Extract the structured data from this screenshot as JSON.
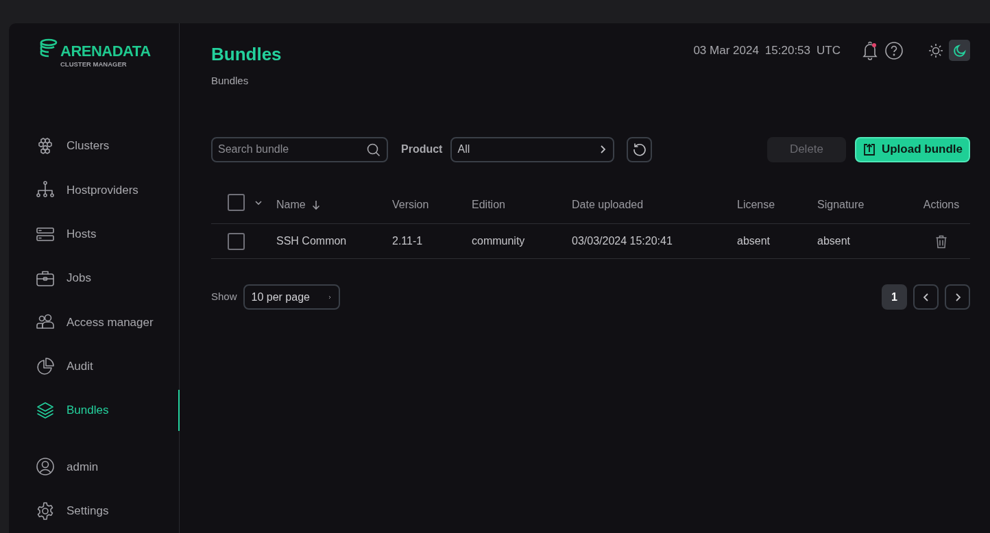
{
  "logo": {
    "title": "ARENADATA",
    "subtitle": "CLUSTER MANAGER"
  },
  "sidebar": {
    "items": [
      {
        "label": "Clusters",
        "selected": false
      },
      {
        "label": "Hostproviders",
        "selected": false
      },
      {
        "label": "Hosts",
        "selected": false
      },
      {
        "label": "Jobs",
        "selected": false
      },
      {
        "label": "Access manager",
        "selected": false
      },
      {
        "label": "Audit",
        "selected": false
      },
      {
        "label": "Bundles",
        "selected": true
      }
    ],
    "footer_items": [
      {
        "label": "admin"
      },
      {
        "label": "Settings"
      }
    ]
  },
  "header": {
    "title": "Bundles",
    "breadcrumb": "Bundles",
    "date": "03 Mar 2024",
    "time": "15:20:53",
    "timezone": "UTC",
    "notifications_unread": true,
    "theme_options": [
      {
        "kind": "light",
        "selected": false
      },
      {
        "kind": "dark",
        "selected": true
      }
    ]
  },
  "toolbar": {
    "search": {
      "placeholder": "Search bundle"
    },
    "product_label": "Product",
    "product_value": "All",
    "delete_button": {
      "label": "Delete",
      "disabled": true
    },
    "upload_button": {
      "label": "Upload bundle"
    }
  },
  "table": {
    "select_all_checked": false,
    "columns": [
      {
        "label": "Name",
        "sort_descending": true
      },
      {
        "label": "Version"
      },
      {
        "label": "Edition"
      },
      {
        "label": "Date uploaded"
      },
      {
        "label": "License"
      },
      {
        "label": "Signature"
      },
      {
        "label": "Actions"
      }
    ],
    "rows": [
      {
        "checked": false,
        "cells": [
          "SSH Common",
          "2.11-1",
          "community",
          "03/03/2024 15:20:41",
          "absent",
          "absent"
        ]
      }
    ]
  },
  "pagination": {
    "show_label": "Show",
    "per_page": "10 per page",
    "pages": [
      {
        "label": "1",
        "selected": true
      }
    ]
  }
}
